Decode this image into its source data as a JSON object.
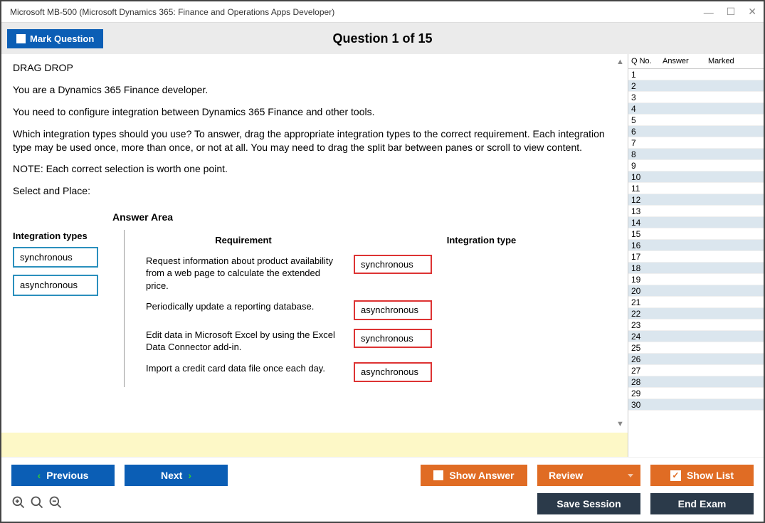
{
  "window": {
    "title": "Microsoft MB-500 (Microsoft Dynamics 365: Finance and Operations Apps Developer)"
  },
  "toolbar": {
    "mark_label": "Mark Question",
    "question_title": "Question 1 of 15"
  },
  "question": {
    "heading": "DRAG DROP",
    "p1": "You are a Dynamics 365 Finance developer.",
    "p2": "You need to configure integration between Dynamics 365 Finance and other tools.",
    "p3": "Which integration types should you use? To answer, drag the appropriate integration types to the correct requirement. Each integration type may be used once, more than once, or not at all. You may need to drag the split bar between panes or scroll to view content.",
    "p4": "NOTE: Each correct selection is worth one point.",
    "p5": "Select and Place:",
    "answer_area_label": "Answer Area",
    "source_header": "Integration types",
    "source_items": [
      "synchronous",
      "asynchronous"
    ],
    "req_header": "Requirement",
    "type_header": "Integration type",
    "rows": [
      {
        "req": "Request information about product availability from a web page to calculate the extended price.",
        "ans": "synchronous"
      },
      {
        "req": "Periodically update a reporting database.",
        "ans": "asynchronous"
      },
      {
        "req": "Edit data in Microsoft Excel by using the Excel Data Connector add-in.",
        "ans": "synchronous"
      },
      {
        "req": "Import a credit card data file once each day.",
        "ans": "asynchronous"
      }
    ]
  },
  "nav": {
    "h1": "Q No.",
    "h2": "Answer",
    "h3": "Marked",
    "count": 30
  },
  "footer": {
    "previous": "Previous",
    "next": "Next",
    "show_answer": "Show Answer",
    "review": "Review",
    "show_list": "Show List",
    "save_session": "Save Session",
    "end_exam": "End Exam"
  }
}
